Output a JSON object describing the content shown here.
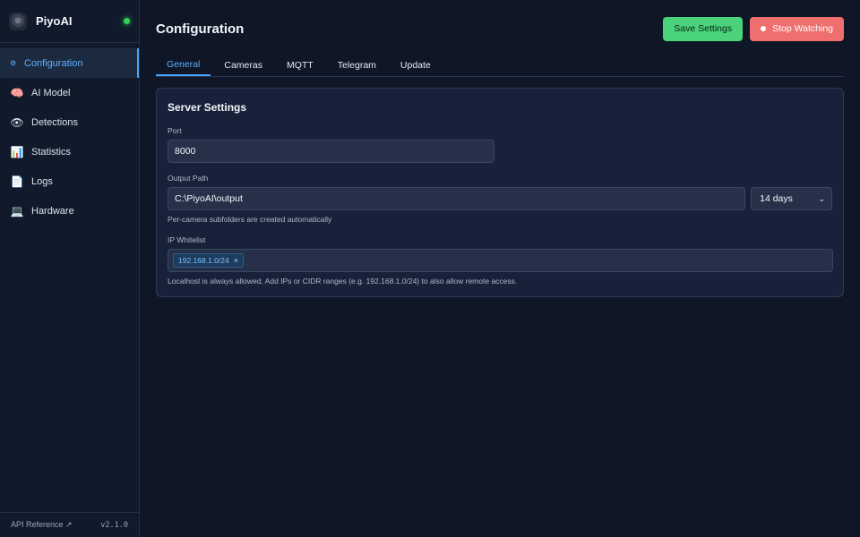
{
  "app": {
    "name": "PiyoAI",
    "status_color": "#34d058"
  },
  "sidebar": {
    "items": [
      {
        "label": "Configuration",
        "icon": "gear-icon",
        "active": true
      },
      {
        "label": "AI Model",
        "icon": "brain-icon"
      },
      {
        "label": "Detections",
        "icon": "eye-icon"
      },
      {
        "label": "Statistics",
        "icon": "bar-chart-icon"
      },
      {
        "label": "Logs",
        "icon": "document-icon"
      },
      {
        "label": "Hardware",
        "icon": "laptop-icon"
      }
    ],
    "footer": {
      "api_reference": "API Reference ↗",
      "version": "v2.1.0"
    }
  },
  "header": {
    "title": "Configuration",
    "save_label": "Save Settings",
    "stop_label": "Stop Watching"
  },
  "tabs": [
    {
      "label": "General",
      "active": true
    },
    {
      "label": "Cameras"
    },
    {
      "label": "MQTT"
    },
    {
      "label": "Telegram"
    },
    {
      "label": "Update"
    }
  ],
  "server_settings": {
    "title": "Server Settings",
    "port": {
      "label": "Port",
      "value": "8000"
    },
    "output_path": {
      "label": "Output Path",
      "value": "C:\\PiyoAI\\output",
      "retention": "14 days",
      "hint": "Per-camera subfolders are created automatically"
    },
    "ip_whitelist": {
      "label": "IP Whitelist",
      "tags": [
        "192.168.1.0/24"
      ],
      "hint": "Localhost is always allowed. Add IPs or CIDR ranges (e.g. 192.168.1.0/24) to also allow remote access."
    }
  },
  "colors": {
    "accent": "#4aa3ff",
    "save": "#4ad37a",
    "stop": "#ef6f6f",
    "background": "#0f1626"
  }
}
